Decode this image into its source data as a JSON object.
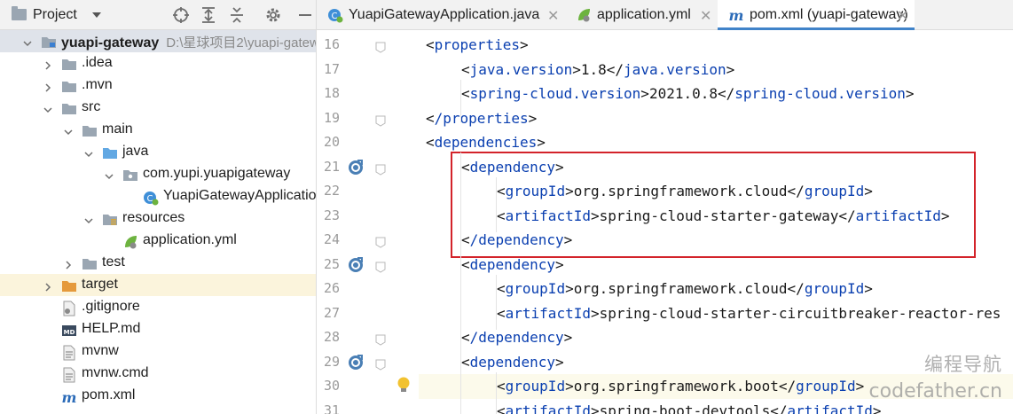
{
  "project_panel": {
    "title": "Project",
    "toolbar_icons": [
      "locate-icon",
      "expand-all-icon",
      "collapse-all-icon",
      "gear-icon",
      "minimize-icon"
    ],
    "tree": [
      {
        "label": "yuapi-gateway",
        "path": "D:\\星球项目2\\yuapi-gatew",
        "indent": 0,
        "chevron": "down",
        "icon": "module-folder",
        "bold": true,
        "selected": true
      },
      {
        "label": ".idea",
        "indent": 1,
        "chevron": "right",
        "icon": "folder"
      },
      {
        "label": ".mvn",
        "indent": 1,
        "chevron": "right",
        "icon": "folder"
      },
      {
        "label": "src",
        "indent": 1,
        "chevron": "down",
        "icon": "folder"
      },
      {
        "label": "main",
        "indent": 2,
        "chevron": "down",
        "icon": "folder"
      },
      {
        "label": "java",
        "indent": 3,
        "chevron": "down",
        "icon": "source-folder"
      },
      {
        "label": "com.yupi.yuapigateway",
        "indent": 4,
        "chevron": "down",
        "icon": "package"
      },
      {
        "label": "YuapiGatewayApplication",
        "indent": 5,
        "chevron": "",
        "icon": "spring-class"
      },
      {
        "label": "resources",
        "indent": 3,
        "chevron": "down",
        "icon": "resources-folder"
      },
      {
        "label": "application.yml",
        "indent": 4,
        "chevron": "",
        "icon": "yml-file"
      },
      {
        "label": "test",
        "indent": 2,
        "chevron": "right",
        "icon": "folder"
      },
      {
        "label": "target",
        "indent": 1,
        "chevron": "right",
        "icon": "excluded-folder",
        "excluded": true
      },
      {
        "label": ".gitignore",
        "indent": 1,
        "chevron": "",
        "icon": "gitignore-file"
      },
      {
        "label": "HELP.md",
        "indent": 1,
        "chevron": "",
        "icon": "markdown-file"
      },
      {
        "label": "mvnw",
        "indent": 1,
        "chevron": "",
        "icon": "script-file"
      },
      {
        "label": "mvnw.cmd",
        "indent": 1,
        "chevron": "",
        "icon": "script-file"
      },
      {
        "label": "pom.xml",
        "indent": 1,
        "chevron": "",
        "icon": "maven-file"
      }
    ]
  },
  "editor": {
    "tabs": [
      {
        "label": "YuapiGatewayApplication.java",
        "icon": "spring-class",
        "active": false
      },
      {
        "label": "application.yml",
        "icon": "yml-file",
        "active": false
      },
      {
        "label": "pom.xml (yuapi-gateway)",
        "icon": "maven-file",
        "active": true
      }
    ],
    "lines": [
      {
        "num": "16",
        "indent": 1,
        "tag": "properties",
        "text": "",
        "close": false,
        "fold": true
      },
      {
        "num": "17",
        "indent": 2,
        "tag": "java.version",
        "text": "1.8",
        "close": true
      },
      {
        "num": "18",
        "indent": 2,
        "tag": "spring-cloud.version",
        "text": "2021.0.8",
        "close": true
      },
      {
        "num": "19",
        "indent": 1,
        "tag": "/properties",
        "text": "",
        "close": false,
        "fold": true
      },
      {
        "num": "20",
        "indent": 1,
        "tag": "dependencies",
        "text": "",
        "close": false
      },
      {
        "num": "21",
        "indent": 2,
        "tag": "dependency",
        "text": "",
        "close": false,
        "fold": true,
        "gutter_icon": "maven-dependency-icon"
      },
      {
        "num": "22",
        "indent": 3,
        "tag": "groupId",
        "text": "org.springframework.cloud",
        "close": true
      },
      {
        "num": "23",
        "indent": 3,
        "tag": "artifactId",
        "text": "spring-cloud-starter-gateway",
        "close": true
      },
      {
        "num": "24",
        "indent": 2,
        "tag": "/dependency",
        "text": "",
        "close": false,
        "fold": true
      },
      {
        "num": "25",
        "indent": 2,
        "tag": "dependency",
        "text": "",
        "close": false,
        "fold": true,
        "gutter_icon": "maven-dependency-icon"
      },
      {
        "num": "26",
        "indent": 3,
        "tag": "groupId",
        "text": "org.springframework.cloud",
        "close": true
      },
      {
        "num": "27",
        "indent": 3,
        "tag": "artifactId",
        "text": "spring-cloud-starter-circuitbreaker-reactor-res",
        "close": false
      },
      {
        "num": "28",
        "indent": 2,
        "tag": "/dependency",
        "text": "",
        "close": false,
        "fold": true
      },
      {
        "num": "29",
        "indent": 2,
        "tag": "dependency",
        "text": "",
        "close": false,
        "fold": true,
        "gutter_icon": "maven-dependency-icon"
      },
      {
        "num": "30",
        "indent": 3,
        "tag": "groupId",
        "text": "org.springframework.boot",
        "close": true,
        "caret": true,
        "bulb": true
      },
      {
        "num": "31",
        "indent": 3,
        "tag": "artifactId",
        "text": "spring-boot-devtools",
        "close": true
      }
    ]
  },
  "watermark": {
    "line1": "编程导航",
    "line2": "codefather.cn"
  },
  "colors": {
    "tag": "#0a3fb0",
    "highlight_box": "#d3232a",
    "active_tab_underline": "#4083c9",
    "selected_row": "#dfe3ea",
    "excluded_row": "#fbf4dc"
  }
}
